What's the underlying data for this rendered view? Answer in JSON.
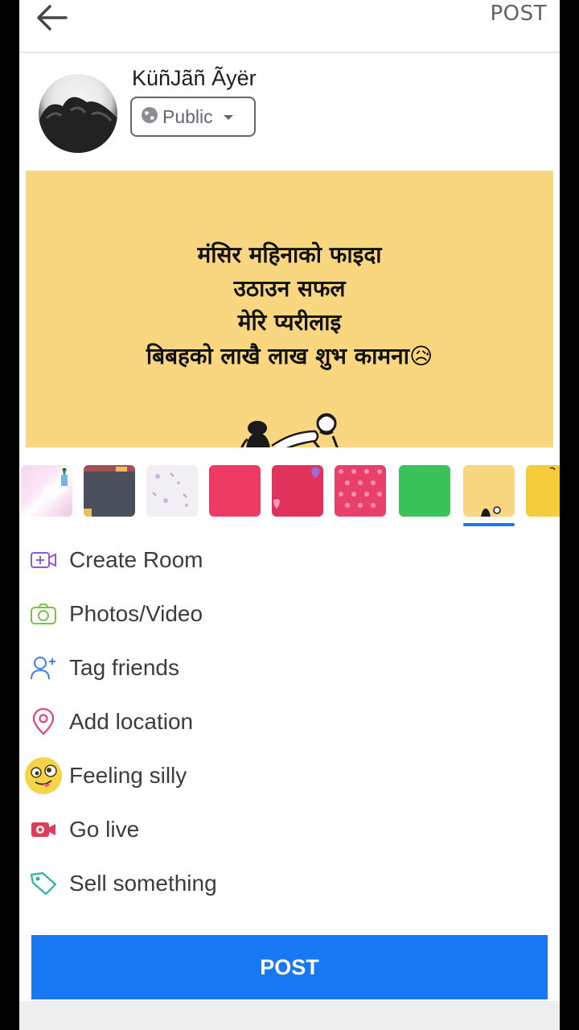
{
  "header": {
    "post_label": "POST"
  },
  "user": {
    "name": "KüñJãñ Ãyër",
    "privacy": "Public"
  },
  "post": {
    "background_color": "#f9d781",
    "lines": [
      "मंसिर महिनाको फाइदा",
      "उठाउन सफल",
      "मेरि प्यरीलाइ",
      "बिबहको लाखै लाख शुभ कामना😥"
    ]
  },
  "backgrounds": [
    {
      "name": "pink-pattern"
    },
    {
      "name": "dark-slate"
    },
    {
      "name": "light-doodle"
    },
    {
      "name": "coral-red"
    },
    {
      "name": "hearts-red"
    },
    {
      "name": "hearts-pink"
    },
    {
      "name": "green"
    },
    {
      "name": "yellow-couple",
      "selected": true
    },
    {
      "name": "yellow"
    }
  ],
  "menu": [
    {
      "label": "Create Room",
      "icon": "video-room-icon"
    },
    {
      "label": "Photos/Video",
      "icon": "camera-icon"
    },
    {
      "label": "Tag friends",
      "icon": "tag-friends-icon"
    },
    {
      "label": "Add location",
      "icon": "location-pin-icon"
    },
    {
      "label": "Feeling silly",
      "icon": "silly-face-icon"
    },
    {
      "label": "Go live",
      "icon": "live-video-icon"
    },
    {
      "label": "Sell something",
      "icon": "price-tag-icon"
    }
  ],
  "footer": {
    "post_button": "POST"
  },
  "colors": {
    "accent": "#1877f2",
    "canvas": "#f9d781"
  }
}
